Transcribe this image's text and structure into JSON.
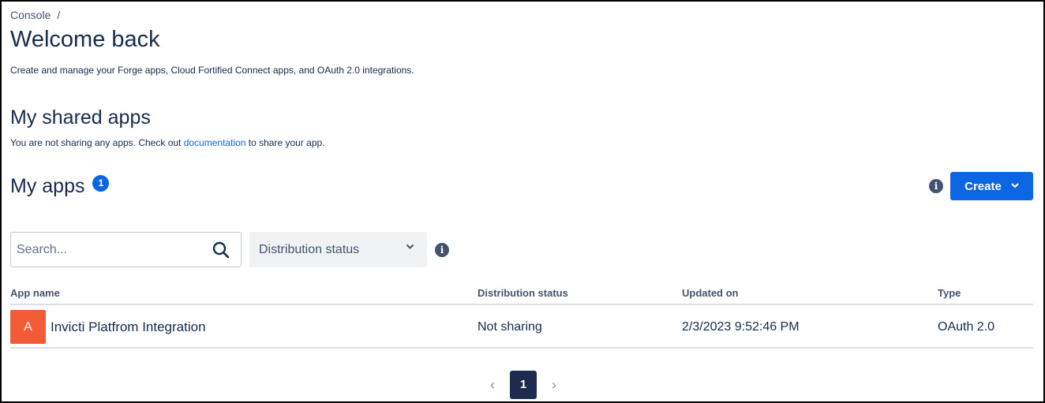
{
  "breadcrumb": {
    "root": "Console",
    "separator": "/"
  },
  "header": {
    "title": "Welcome back",
    "subtitle": "Create and manage your Forge apps, Cloud Fortified Connect apps, and OAuth 2.0 integrations."
  },
  "shared_apps": {
    "heading": "My shared apps",
    "text_before": "You are not sharing any apps. Check out ",
    "link": "documentation",
    "text_after": " to share your app."
  },
  "my_apps": {
    "heading": "My apps",
    "count": "1",
    "info_icon": "info-icon",
    "create_label": "Create",
    "create_icon": "chevron-down-icon"
  },
  "filters": {
    "search_placeholder": "Search...",
    "search_icon": "search-icon",
    "distribution_status": "Distribution status",
    "info_icon": "info-icon"
  },
  "table": {
    "columns": [
      "App name",
      "Distribution status",
      "Updated on",
      "Type"
    ],
    "rows": [
      {
        "avatar": "A",
        "name": "Invicti Platfrom Integration",
        "distribution_status": "Not sharing",
        "updated_on": "2/3/2023 9:52:46 PM",
        "type": "OAuth 2.0"
      }
    ]
  },
  "pagination": {
    "prev": "‹",
    "current": "1",
    "next": "›"
  },
  "colors": {
    "accent": "#0c66e4",
    "avatar": "#f15b36",
    "page_active": "#1d2b4f",
    "text": "#172b4d"
  }
}
